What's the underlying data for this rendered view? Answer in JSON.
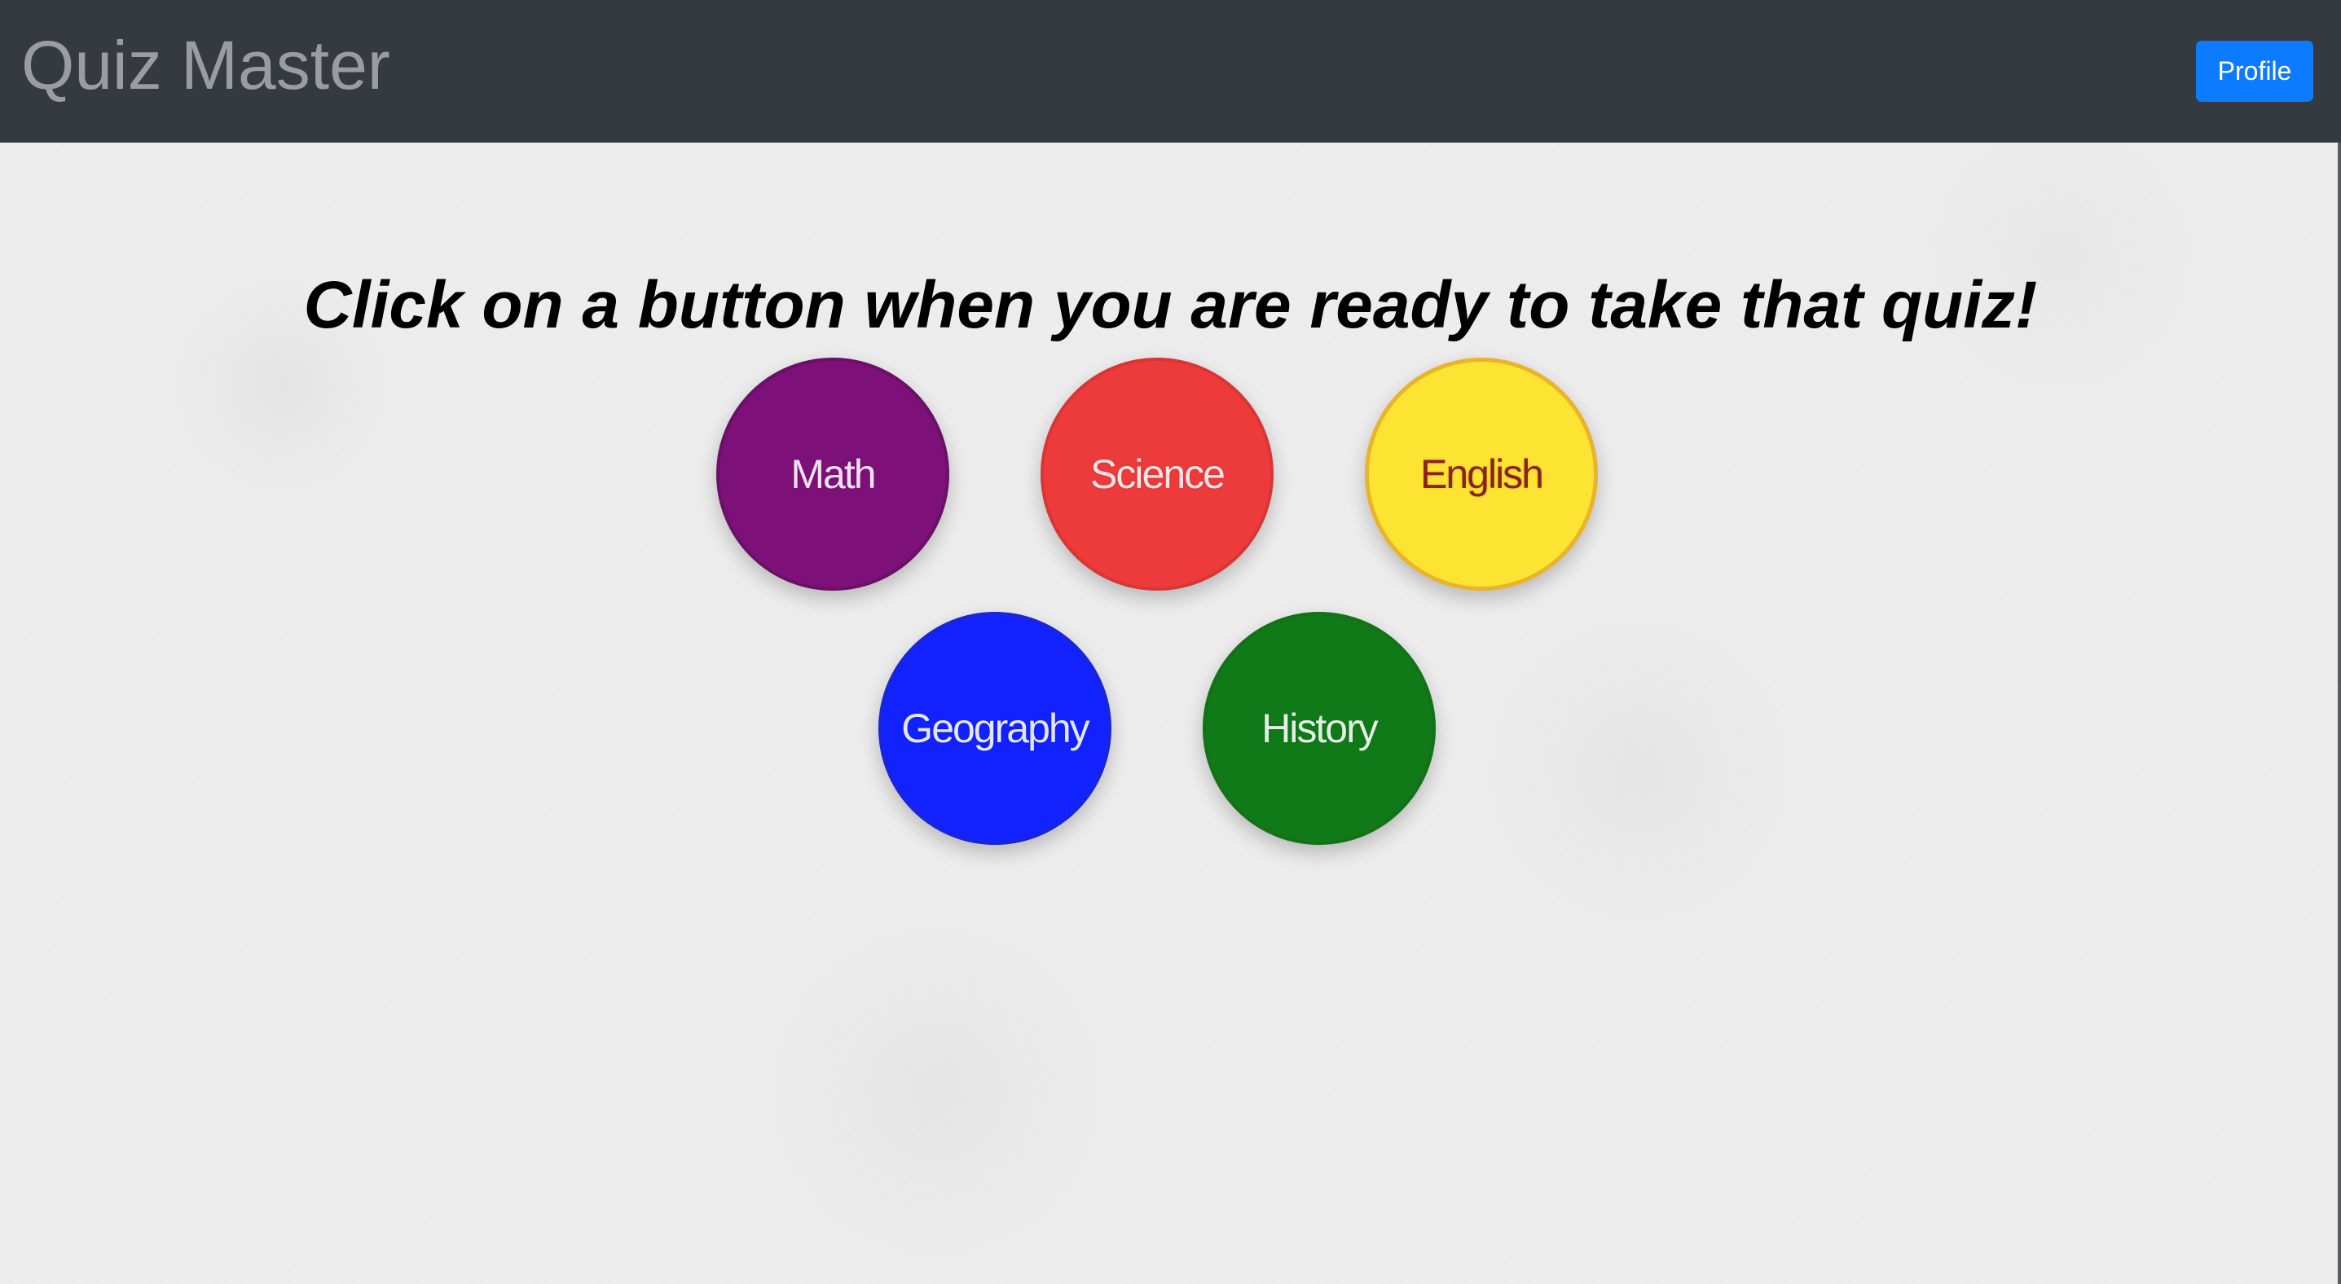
{
  "navbar": {
    "brand": "Quiz Master",
    "profile_label": "Profile"
  },
  "main": {
    "headline": "Click on a button when you are ready to take that quiz!",
    "quizzes": [
      {
        "label": "Math",
        "color": "#7d1179",
        "text_color": "#f1dff2"
      },
      {
        "label": "Science",
        "color": "#ec3b3a",
        "text_color": "#fbe3e6"
      },
      {
        "label": "English",
        "color": "#fde332",
        "text_color": "#8a2220"
      },
      {
        "label": "Geography",
        "color": "#1222ff",
        "text_color": "#e3e6fb"
      },
      {
        "label": "History",
        "color": "#107a18",
        "text_color": "#e3efe4"
      }
    ]
  },
  "colors": {
    "navbar_bg": "#343a40",
    "profile_button": "#0d7bff",
    "page_bg": "#ededed"
  }
}
